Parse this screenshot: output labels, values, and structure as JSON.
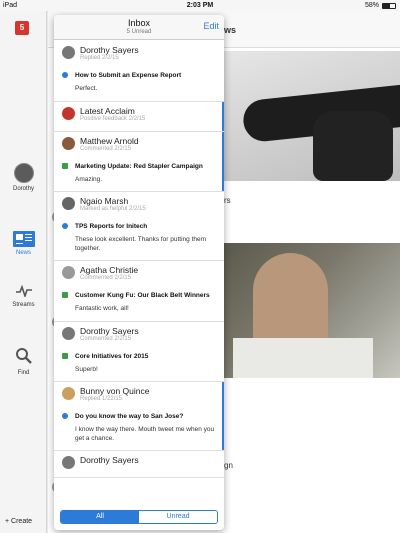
{
  "status": {
    "device": "iPad",
    "time": "2:03 PM",
    "battery": "58%",
    "battery_level": 0.58
  },
  "rail": {
    "logo": "5",
    "profile_label": "Dorothy",
    "news_label": "News",
    "streams_label": "Streams",
    "find_label": "Find",
    "create_label": "Create"
  },
  "feed": {
    "title_fragment": "ws",
    "caption1_fragment": "rs",
    "caption2_fragment": "gn"
  },
  "inbox": {
    "title": "Inbox",
    "subtitle": "5 Unread",
    "edit_label": "Edit",
    "items": [
      {
        "name": "Dorothy Sayers",
        "meta": "Replied 2/2/15",
        "subject": "How to Submit an Expense Report",
        "body": "Perfect.",
        "kind": "q",
        "unread": false,
        "avatar": "#777777"
      },
      {
        "name": "Latest Acclaim",
        "meta": "Positive feedback 2/2/15",
        "subject": "",
        "body": "",
        "kind": "",
        "unread": true,
        "avatar": "#c2362d"
      },
      {
        "name": "Matthew Arnold",
        "meta": "Commented 2/2/15",
        "subject": "Marketing Update: Red Stapler Campaign",
        "body": "Amazing.",
        "kind": "c",
        "unread": true,
        "avatar": "#8a5a3c"
      },
      {
        "name": "Ngaio Marsh",
        "meta": "Marked as helpful 2/2/15",
        "subject": "TPS Reports for Initech",
        "body": "These look excellent. Thanks for putting them together.",
        "kind": "q",
        "unread": false,
        "avatar": "#666666"
      },
      {
        "name": "Agatha Christie",
        "meta": "Commented 2/2/15",
        "subject": "Customer Kung Fu: Our Black Belt Winners",
        "body": "Fantastic work, all!",
        "kind": "c",
        "unread": false,
        "avatar": "#999999"
      },
      {
        "name": "Dorothy Sayers",
        "meta": "Commented 2/2/15",
        "subject": "Core Initiatives for 2015",
        "body": "Superb!",
        "kind": "c",
        "unread": false,
        "avatar": "#777777"
      },
      {
        "name": "Bunny von Quince",
        "meta": "Replied 1/22/15",
        "subject": "Do you know the way to San Jose?",
        "body": "I know the way there. Mouth tweet me when you get a chance.",
        "kind": "q",
        "unread": true,
        "avatar": "#c9a060"
      },
      {
        "name": "Dorothy Sayers",
        "meta": "",
        "subject": "",
        "body": "",
        "kind": "",
        "unread": false,
        "avatar": "#777777"
      }
    ],
    "tabs": {
      "all_label": "All",
      "unread_label": "Unread",
      "selected": "All"
    }
  }
}
